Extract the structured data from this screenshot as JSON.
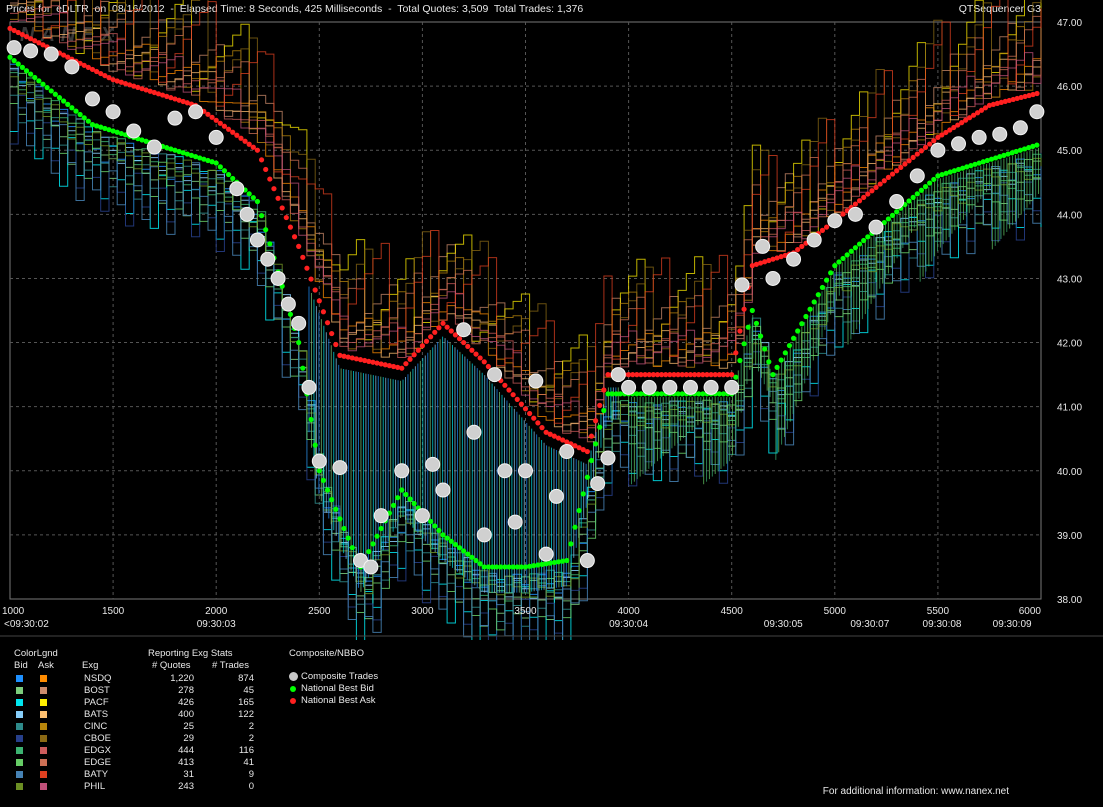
{
  "header": {
    "title": "Prices for  eDLTR  on  08/16/2012  -  Elapsed Time: 8 Seconds, 425 Milliseconds  -  Total Quotes: 3,509  Total Trades: 1,376",
    "app_name": "QTSequencer G3",
    "watermark": "NANEX"
  },
  "chart_data": {
    "type": "scatter",
    "x_ticks": [
      1000,
      1500,
      2000,
      2500,
      3000,
      3500,
      4000,
      4500,
      5000,
      5500,
      6000
    ],
    "y_ticks": [
      "47.00",
      "46.00",
      "45.00",
      "44.00",
      "43.00",
      "42.00",
      "41.00",
      "40.00",
      "39.00",
      "38.00"
    ],
    "ylim": [
      38.0,
      47.0
    ],
    "xlim": [
      1000,
      6000
    ],
    "time_labels": [
      {
        "label": "<09:30:02",
        "x": 1000
      },
      {
        "label": "09:30:03",
        "x": 2000
      },
      {
        "label": "09:30:04",
        "x": 4000
      },
      {
        "label": "09:30:05",
        "x": 4750
      },
      {
        "label": "09:30:07",
        "x": 5170
      },
      {
        "label": "09:30:08",
        "x": 5520
      },
      {
        "label": "09:30:09",
        "x": 5860
      }
    ],
    "grid": true,
    "trades": [
      [
        1020,
        46.6
      ],
      [
        1100,
        46.55
      ],
      [
        1200,
        46.5
      ],
      [
        1300,
        46.3
      ],
      [
        1400,
        45.8
      ],
      [
        1500,
        45.6
      ],
      [
        1600,
        45.3
      ],
      [
        1700,
        45.05
      ],
      [
        1800,
        45.5
      ],
      [
        1900,
        45.6
      ],
      [
        2000,
        45.2
      ],
      [
        2100,
        44.4
      ],
      [
        2150,
        44.0
      ],
      [
        2200,
        43.6
      ],
      [
        2250,
        43.3
      ],
      [
        2300,
        43.0
      ],
      [
        2350,
        42.6
      ],
      [
        2400,
        42.3
      ],
      [
        2450,
        41.3
      ],
      [
        2500,
        40.15
      ],
      [
        2600,
        40.05
      ],
      [
        2700,
        38.6
      ],
      [
        2750,
        38.5
      ],
      [
        2800,
        39.3
      ],
      [
        2900,
        40.0
      ],
      [
        3000,
        39.3
      ],
      [
        3050,
        40.1
      ],
      [
        3100,
        39.7
      ],
      [
        3200,
        42.2
      ],
      [
        3250,
        40.6
      ],
      [
        3300,
        39.0
      ],
      [
        3350,
        41.5
      ],
      [
        3400,
        40.0
      ],
      [
        3450,
        39.2
      ],
      [
        3500,
        40.0
      ],
      [
        3550,
        41.4
      ],
      [
        3600,
        38.7
      ],
      [
        3650,
        39.6
      ],
      [
        3700,
        40.3
      ],
      [
        3800,
        38.6
      ],
      [
        3850,
        39.8
      ],
      [
        3900,
        40.2
      ],
      [
        3950,
        41.5
      ],
      [
        4000,
        41.3
      ],
      [
        4100,
        41.3
      ],
      [
        4200,
        41.3
      ],
      [
        4300,
        41.3
      ],
      [
        4400,
        41.3
      ],
      [
        4500,
        41.3
      ],
      [
        4550,
        42.9
      ],
      [
        4650,
        43.5
      ],
      [
        4700,
        43.0
      ],
      [
        4800,
        43.3
      ],
      [
        4900,
        43.6
      ],
      [
        5000,
        43.9
      ],
      [
        5100,
        44.0
      ],
      [
        5200,
        43.8
      ],
      [
        5300,
        44.2
      ],
      [
        5400,
        44.6
      ],
      [
        5500,
        45.0
      ],
      [
        5600,
        45.1
      ],
      [
        5700,
        45.2
      ],
      [
        5800,
        45.25
      ],
      [
        5900,
        45.35
      ],
      [
        5980,
        45.6
      ]
    ],
    "best_bid": [
      [
        1000,
        46.45
      ],
      [
        1400,
        45.4
      ],
      [
        1700,
        45.1
      ],
      [
        2000,
        44.8
      ],
      [
        2200,
        44.2
      ],
      [
        2400,
        42.0
      ],
      [
        2500,
        40.0
      ],
      [
        2700,
        38.5
      ],
      [
        2900,
        39.7
      ],
      [
        3100,
        39.0
      ],
      [
        3300,
        38.5
      ],
      [
        3500,
        38.5
      ],
      [
        3700,
        38.6
      ],
      [
        3900,
        41.2
      ],
      [
        4500,
        41.2
      ],
      [
        4600,
        42.5
      ],
      [
        4700,
        41.5
      ],
      [
        5000,
        43.2
      ],
      [
        5500,
        44.6
      ],
      [
        6000,
        45.1
      ]
    ],
    "best_ask": [
      [
        1000,
        46.9
      ],
      [
        1500,
        46.1
      ],
      [
        1900,
        45.7
      ],
      [
        2200,
        45.0
      ],
      [
        2400,
        43.5
      ],
      [
        2600,
        41.8
      ],
      [
        2900,
        41.6
      ],
      [
        3100,
        42.3
      ],
      [
        3300,
        41.7
      ],
      [
        3600,
        40.6
      ],
      [
        3800,
        40.3
      ],
      [
        3900,
        41.5
      ],
      [
        4500,
        41.5
      ],
      [
        4600,
        43.2
      ],
      [
        4800,
        43.4
      ],
      [
        5000,
        43.9
      ],
      [
        5500,
        45.2
      ],
      [
        5750,
        45.7
      ],
      [
        6000,
        45.9
      ]
    ]
  },
  "legend": {
    "col_headers": {
      "colorlegend": "ColorLgnd",
      "bid": "Bid",
      "ask": "Ask",
      "exg": "Exg",
      "reporting": "Reporting Exg Stats",
      "quotes": "# Quotes",
      "trades": "# Trades",
      "composite": "Composite/NBBO"
    },
    "exchanges": [
      {
        "name": "NSDQ",
        "quotes": "1,220",
        "trades": "874",
        "bid_color": "#1e90ff",
        "ask_color": "#ff8c00"
      },
      {
        "name": "BOST",
        "quotes": "278",
        "trades": "45",
        "bid_color": "#7ccd7c",
        "ask_color": "#cd8c6c"
      },
      {
        "name": "PACF",
        "quotes": "426",
        "trades": "165",
        "bid_color": "#00e5ee",
        "ask_color": "#ffee00"
      },
      {
        "name": "BATS",
        "quotes": "400",
        "trades": "122",
        "bid_color": "#87cefa",
        "ask_color": "#ffc070"
      },
      {
        "name": "CINC",
        "quotes": "25",
        "trades": "2",
        "bid_color": "#2e8b8b",
        "ask_color": "#b8860b"
      },
      {
        "name": "CBOE",
        "quotes": "29",
        "trades": "2",
        "bid_color": "#27408b",
        "ask_color": "#8b6914"
      },
      {
        "name": "EDGX",
        "quotes": "444",
        "trades": "116",
        "bid_color": "#3cb371",
        "ask_color": "#cd5c5c"
      },
      {
        "name": "EDGE",
        "quotes": "413",
        "trades": "41",
        "bid_color": "#66cd66",
        "ask_color": "#cd7055"
      },
      {
        "name": "BATY",
        "quotes": "31",
        "trades": "9",
        "bid_color": "#4682b4",
        "ask_color": "#e04020"
      },
      {
        "name": "PHIL",
        "quotes": "243",
        "trades": "0",
        "bid_color": "#6b8e23",
        "ask_color": "#c0507a"
      }
    ],
    "composite_items": [
      {
        "label": "Composite Trades",
        "color": "#c8c8c8",
        "shape": "circle"
      },
      {
        "label": "National Best Bid",
        "color": "#00ff00",
        "shape": "dot"
      },
      {
        "label": "National Best Ask",
        "color": "#ff2020",
        "shape": "dot"
      }
    ]
  },
  "footer": {
    "text": "For additional information: www.nanex.net"
  }
}
